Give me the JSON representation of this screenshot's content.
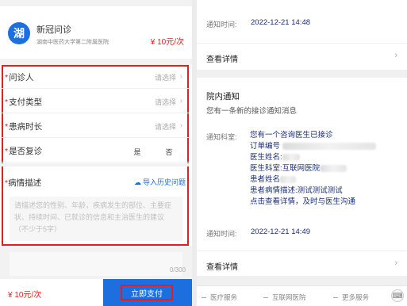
{
  "left": {
    "service": {
      "logo_char": "湖",
      "name": "新冠问诊",
      "hospital": "湖南中医药大学第二附属医院",
      "price": "¥ 10元/次"
    },
    "form": {
      "rows": [
        {
          "label": "问诊人",
          "value": "请选择"
        },
        {
          "label": "支付类型",
          "value": "请选择"
        },
        {
          "label": "患病时长",
          "value": "请选择"
        },
        {
          "label": "是否复诊",
          "yes": "是",
          "no": "否"
        }
      ],
      "required_mark": "*",
      "description_label": "病情描述",
      "import_label": "导入历史问题",
      "description_placeholder": "请描述您的性别、年龄，疾病发生的部位、主要症状、持续时间、已就诊的信息和主治医生的建议（不少于5字）",
      "counter": "0/300"
    },
    "bottom": {
      "price": "¥ 10元/次",
      "pay_button": "立即支付"
    }
  },
  "right": {
    "card1": {
      "time_label": "通知时间:",
      "time_value": "2022-12-21 14:48",
      "detail_label": "查看详情"
    },
    "card2": {
      "title": "院内通知",
      "subtitle": "您有一条新的接诊通知消息",
      "dept_label": "通知科室:",
      "lines": [
        "您有一个咨询医生已接诊",
        "订单编号",
        "医生姓名:",
        "医生科室:互联网医院",
        "患者姓名",
        "患者病情描述:测试测试测试",
        "点击查看详情，及时与医生沟通"
      ],
      "time_label": "通知时间:",
      "time_value": "2022-12-21 14:49",
      "detail_label": "查看详情"
    },
    "tabbar": {
      "tabs": [
        "医疗服务",
        "互联网医院",
        "更多服务"
      ],
      "keyboard_icon": "keyboard-icon"
    }
  }
}
